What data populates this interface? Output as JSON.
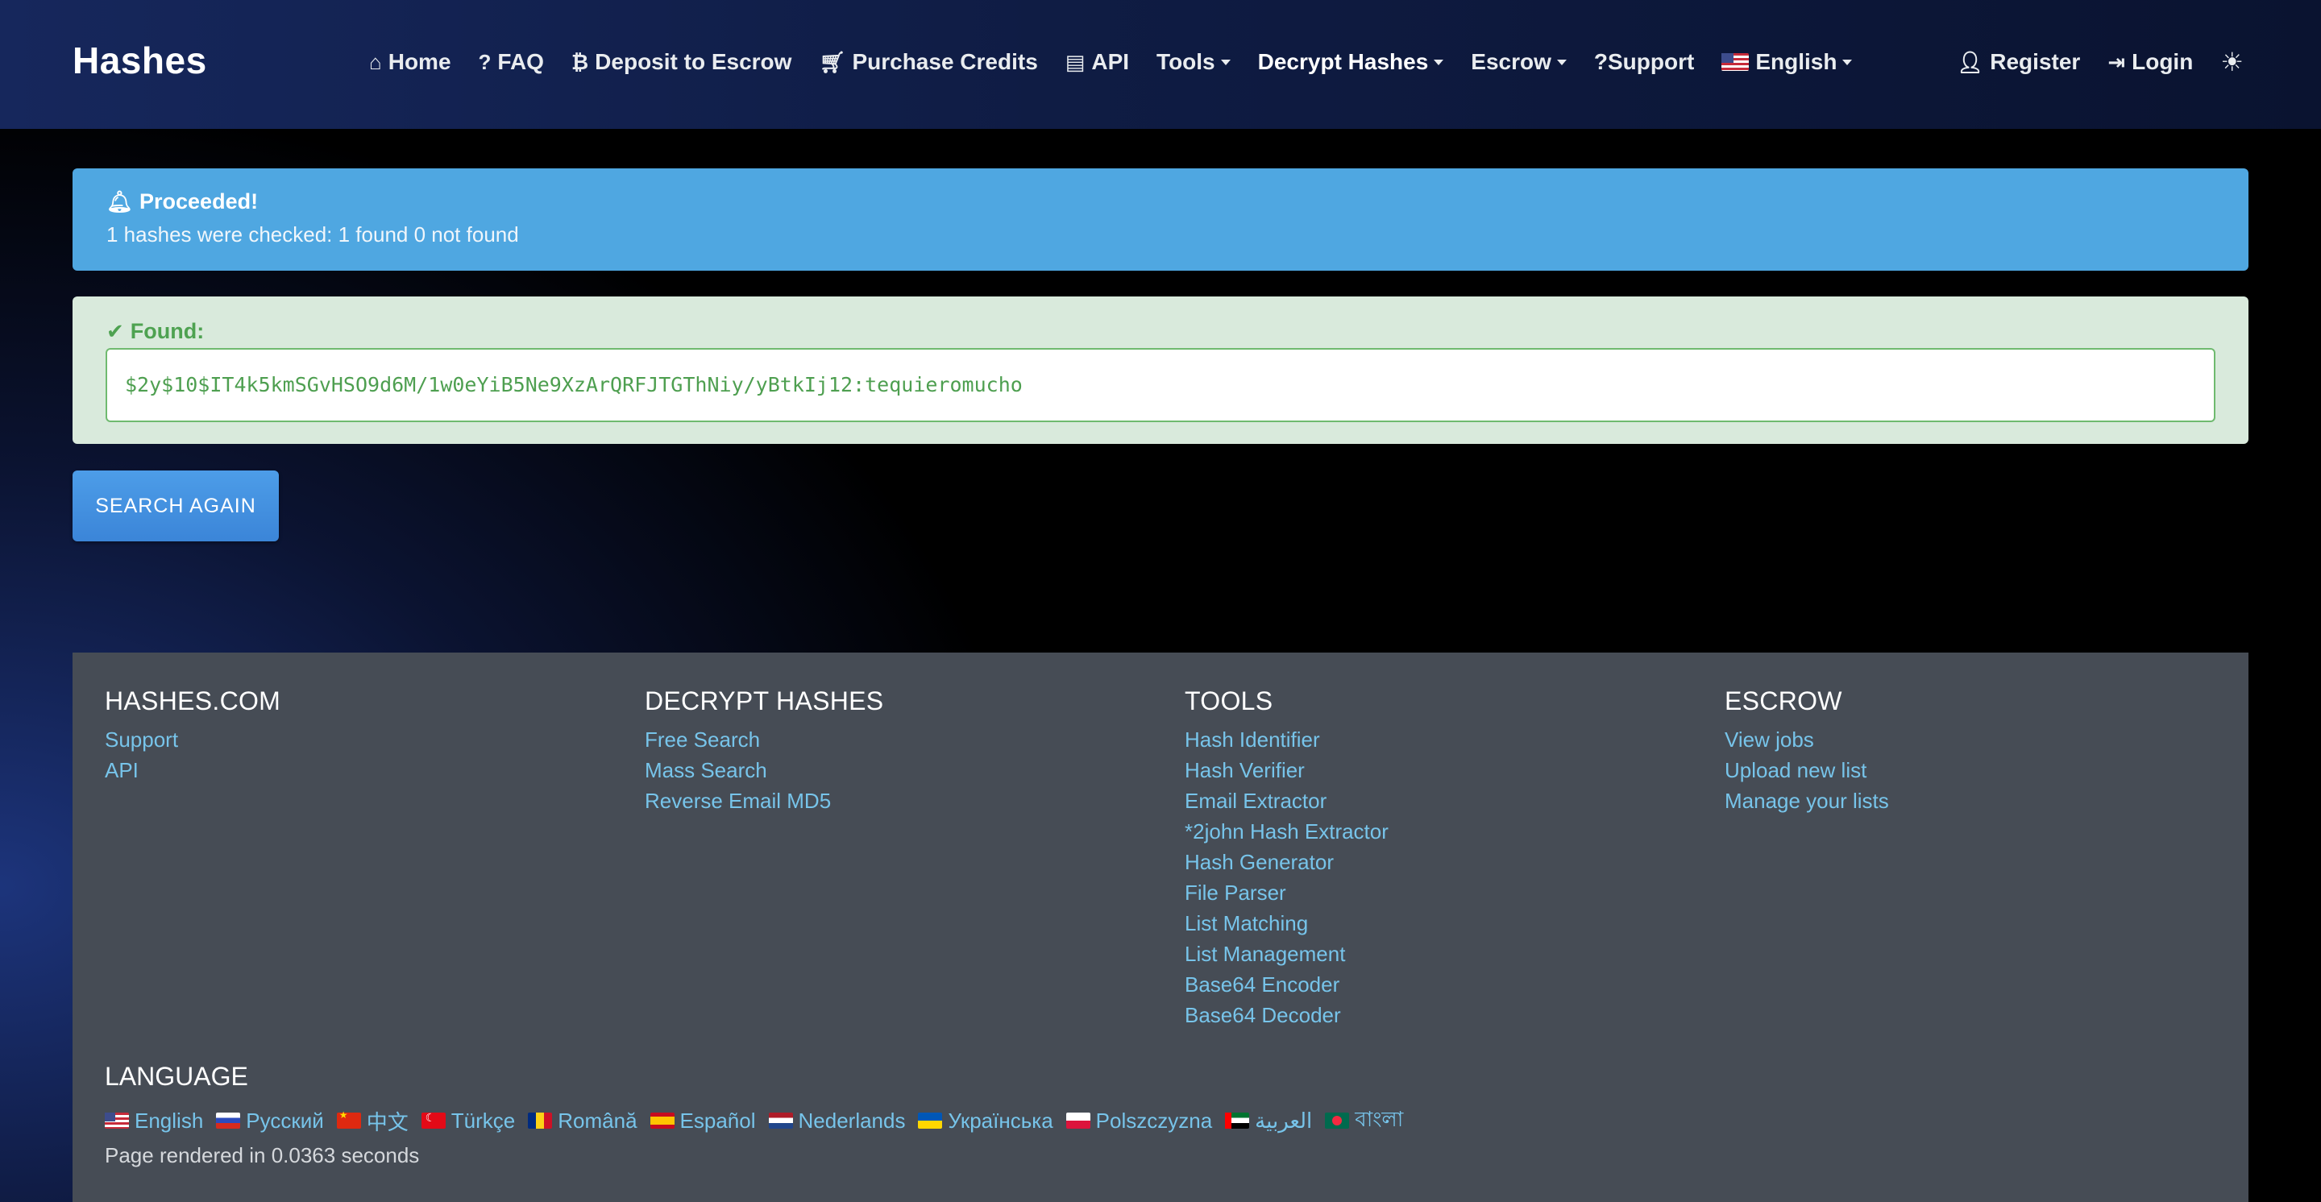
{
  "navbar": {
    "brand": "Hashes",
    "items": [
      {
        "icon": "home-icon",
        "label": "Home"
      },
      {
        "icon": "question-icon",
        "label": "FAQ"
      },
      {
        "icon": "bitcoin-icon",
        "label": "Deposit to Escrow"
      },
      {
        "icon": "cart-icon",
        "label": "Purchase Credits"
      },
      {
        "icon": "api-card-icon",
        "label": "API"
      },
      {
        "label": "Tools",
        "dropdown": true
      },
      {
        "label": "Decrypt Hashes",
        "dropdown": true,
        "active": true
      },
      {
        "label": "Escrow",
        "dropdown": true
      },
      {
        "label": "?Support"
      },
      {
        "icon": "us-flag-icon",
        "label": "English",
        "dropdown": true
      }
    ],
    "right": {
      "register": "Register",
      "login": "Login",
      "theme_icon": "sun-icon"
    }
  },
  "alert_info": {
    "icon": "bell-icon",
    "title": "Proceeded!",
    "message": "1 hashes were checked: 1 found 0 not found",
    "color": "#4fa7e1"
  },
  "alert_found": {
    "icon": "check-icon",
    "title": "Found:",
    "value": "$2y$10$IT4k5kmSGvHSO9d6M/1w0eYiB5Ne9XzArQRFJTGThNiy/yBtkIj12:tequieromucho",
    "color": "#d9eadc"
  },
  "search_again": "SEARCH AGAIN",
  "footer": {
    "columns": [
      {
        "heading": "HASHES.COM",
        "links": [
          "Support",
          "API"
        ]
      },
      {
        "heading": "DECRYPT HASHES",
        "links": [
          "Free Search",
          "Mass Search",
          "Reverse Email MD5"
        ]
      },
      {
        "heading": "TOOLS",
        "links": [
          "Hash Identifier",
          "Hash Verifier",
          "Email Extractor",
          "*2john Hash Extractor",
          "Hash Generator",
          "File Parser",
          "List Matching",
          "List Management",
          "Base64 Encoder",
          "Base64 Decoder"
        ]
      },
      {
        "heading": "ESCROW",
        "links": [
          "View jobs",
          "Upload new list",
          "Manage your lists"
        ]
      }
    ],
    "language_heading": "LANGUAGE",
    "languages": [
      {
        "flag": "us",
        "label": "English"
      },
      {
        "flag": "ru",
        "label": "Русский"
      },
      {
        "flag": "cn",
        "label": "中文"
      },
      {
        "flag": "tr",
        "label": "Türkçe"
      },
      {
        "flag": "ro",
        "label": "Română"
      },
      {
        "flag": "es",
        "label": "Español"
      },
      {
        "flag": "nl",
        "label": "Nederlands"
      },
      {
        "flag": "ua",
        "label": "Українська"
      },
      {
        "flag": "pl",
        "label": "Polszczyzna"
      },
      {
        "flag": "ae",
        "label": "العربية"
      },
      {
        "flag": "bd",
        "label": "বাংলা"
      }
    ],
    "render_time": "Page rendered in 0.0363 seconds"
  }
}
